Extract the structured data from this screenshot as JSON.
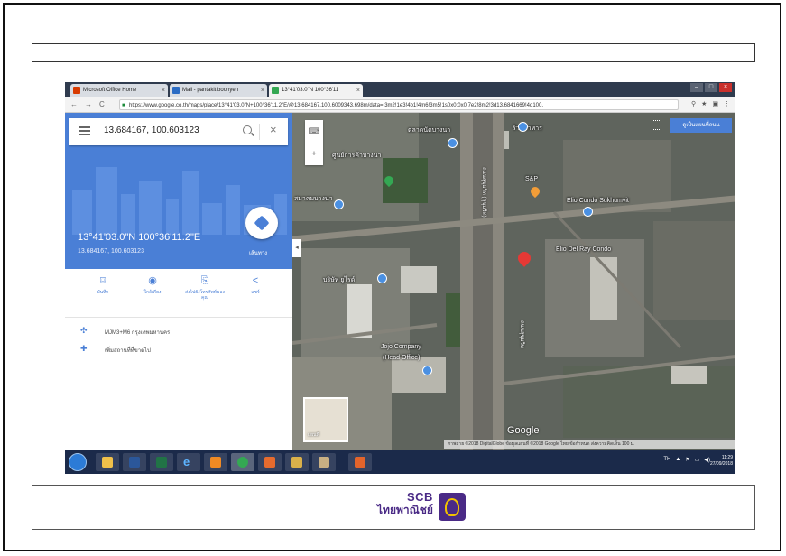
{
  "browser": {
    "tabs": [
      {
        "label": "Microsoft Office Home",
        "close": "×",
        "color": "#d83b01"
      },
      {
        "label": "Mail - pantakit.boonyen",
        "close": "×",
        "color": "#2b6cc4"
      },
      {
        "label": "13°41'03.0\"N 100°36'11",
        "close": "×",
        "color": "#34a853"
      }
    ],
    "window_controls": [
      "–",
      "□",
      "×"
    ],
    "back": "←",
    "forward": "→",
    "reload": "C",
    "url": "https://www.google.co.th/maps/place/13°41'03.0\"N+100°36'11.2\"E/@13.684167,100.6009343,698m/data=!3m2!1e3!4b1!4m6!3m5!1s0x0:0x0!7e2!8m2!3d13.6841669!4d100.",
    "toolbar_icons": [
      "⚲",
      "★",
      "▣",
      "⋮"
    ]
  },
  "panel": {
    "search_value": "13.684167, 100.603123",
    "coord_title": "13°41'03.0\"N 100°36'11.2\"E",
    "coord_sub": "13.684167, 100.603123",
    "directions_label": "เส้นทาง",
    "actions": [
      {
        "icon": "bookmark-icon",
        "glyph": "⌑",
        "label": "บันทึก"
      },
      {
        "icon": "nearby-icon",
        "glyph": "◉",
        "label": "ใกล้เคียง"
      },
      {
        "icon": "send-to-phone-icon",
        "glyph": "⎘",
        "label": "ส่งไปยังโทรศัพท์ของคุณ"
      },
      {
        "icon": "share-icon",
        "glyph": "<",
        "label": "แชร์"
      }
    ],
    "info": [
      {
        "icon": "plus-code-icon",
        "glyph": "✣",
        "text": "MJM3+M6 กรุงเทพมหานคร"
      },
      {
        "icon": "add-place-icon",
        "glyph": "✚",
        "text": "เพิ่มสถานที่ที่ขาดไป"
      }
    ]
  },
  "map": {
    "sat_button": "ดูเป็นแผนที่ถนน",
    "collapse": "◂",
    "zoom": [
      "⌨",
      "+"
    ],
    "labels": [
      {
        "text": "ตลาดนัดบางนา"
      },
      {
        "text": "ศูนย์การค้าบางนา"
      },
      {
        "text": "สมาคมบางนา"
      },
      {
        "text": "Elio Condo Sukhumvit"
      },
      {
        "text": "Elio Del Ray Condo"
      },
      {
        "text": "บริษัท ยูไรด์"
      },
      {
        "text": "Jojo Company"
      },
      {
        "text": "(Head Office)"
      },
      {
        "text": "S&P"
      },
      {
        "text": "ร้านอาหาร"
      }
    ],
    "road_labels": [
      "ถนนสุขุมวิท (สุขุมวิท)",
      "ถนนสุขุมวิท"
    ],
    "google_logo": "Google",
    "minimap_label": "แผนที่",
    "attribution": "ภาพถ่าย ©2018 DigitalGlobe ข้อมูลแผนที่ ©2018 Google   ไทย   ข้อกำหนด   ส่งความคิดเห็น   100 ม."
  },
  "taskbar": {
    "apps": [
      {
        "name": "file-explorer-icon",
        "color": "#f1c14a"
      },
      {
        "name": "word-icon",
        "color": "#2b579a"
      },
      {
        "name": "excel-icon",
        "color": "#217346"
      },
      {
        "name": "ie-icon",
        "color": "#5db4ff"
      },
      {
        "name": "media-icon",
        "color": "#f08a24"
      },
      {
        "name": "chrome-icon",
        "color": "#34a853"
      },
      {
        "name": "home-app-icon",
        "color": "#e66b2e"
      },
      {
        "name": "folder-icon",
        "color": "#d9b04a"
      },
      {
        "name": "people-app-icon",
        "color": "#c9b083"
      },
      {
        "name": "office-icon",
        "color": "#e3642b"
      }
    ],
    "ie_glyph": "e",
    "tray_lang": "TH",
    "tray_icons": [
      "▲",
      "⚑",
      "▭",
      "◀)"
    ],
    "time": "11:29",
    "date": "27/09/2018"
  },
  "footer": {
    "brand_top": "SCB",
    "brand_bottom": "ไทยพาณิชย์"
  }
}
